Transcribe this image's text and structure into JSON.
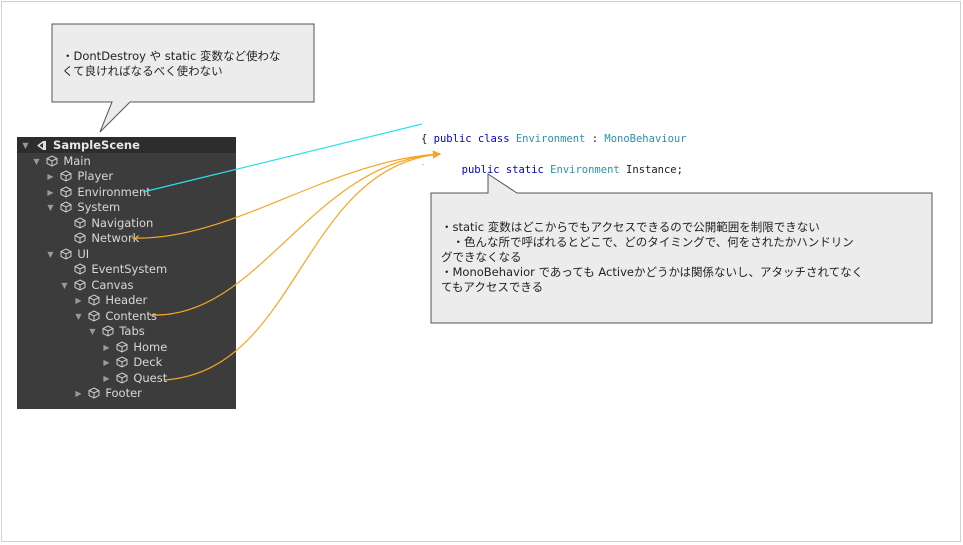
{
  "callout_top": {
    "text": "・DontDestroy や static 変数など使わな\nくて良ければなるべく使わない"
  },
  "callout_bottom": {
    "text": "・static 変数はどこからでもアクセスできるので公開範囲を制限できない\n　・色んな所で呼ばれるとどこで、どのタイミングで、何をされたかハンドリン\nグできなくなる\n・MonoBehavior であっても Activeかどうかは関係ないし、アタッチされてなく\nてもアクセスできる"
  },
  "hierarchy": {
    "scene": "SampleScene",
    "items": [
      {
        "label": "Main"
      },
      {
        "label": "Player"
      },
      {
        "label": "Environment"
      },
      {
        "label": "System"
      },
      {
        "label": "Navigation"
      },
      {
        "label": "Network"
      },
      {
        "label": "UI"
      },
      {
        "label": "EventSystem"
      },
      {
        "label": "Canvas"
      },
      {
        "label": "Header"
      },
      {
        "label": "Contents"
      },
      {
        "label": "Tabs"
      },
      {
        "label": "Home"
      },
      {
        "label": "Deck"
      },
      {
        "label": "Quest"
      },
      {
        "label": "Footer"
      }
    ]
  },
  "code": {
    "line1_kw": "public class",
    "line1_type": "Environment",
    "line1_sep": ":",
    "line1_base": "MonoBehaviour",
    "line2": "{",
    "line3_kw": "public static",
    "line3_type": "Environment",
    "line3_rest": "Instance;"
  },
  "colors": {
    "connector_cyan": "#2de0e8",
    "connector_orange": "#f5a623",
    "hierarchy_bg": "#3c3c3c",
    "callout_bg": "#ececec",
    "keyword": "#0000cc",
    "type": "#2b91af"
  },
  "icons": [
    "unity-scene-icon",
    "gameobject-cube-icon",
    "fold-arrow-icon"
  ]
}
